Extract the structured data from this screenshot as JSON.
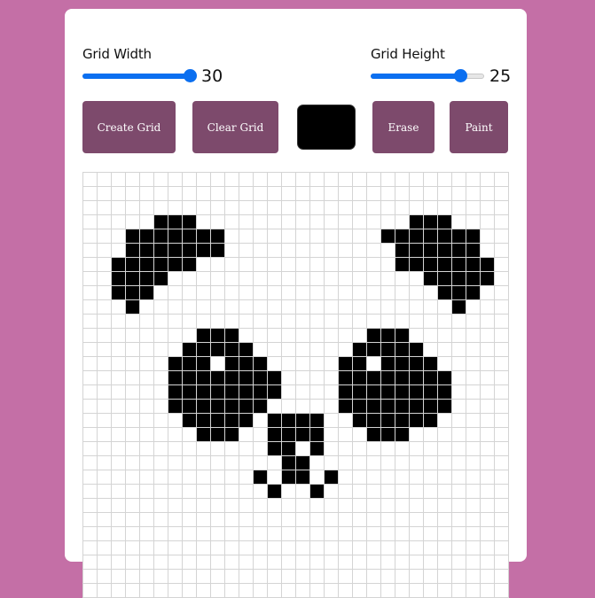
{
  "controls": {
    "width_label": "Grid Width",
    "width_value": "30",
    "width_min": 1,
    "width_max": 30,
    "width_current": 30,
    "height_label": "Grid Height",
    "height_value": "25",
    "height_min": 1,
    "height_max": 30,
    "height_current": 25
  },
  "buttons": {
    "create_label": "Create Grid",
    "clear_label": "Clear Grid",
    "erase_label": "Erase",
    "paint_label": "Paint"
  },
  "colors": {
    "paint_color": "#000000",
    "background": "#c46fa6",
    "button": "#7d4a6c",
    "accent": "#0b6ff0"
  },
  "grid": {
    "columns": 30,
    "rows": 30,
    "painted_rows": [
      "..............................",
      "..............................",
      "..............................",
      ".....OOO...............OOO....",
      "...OOOOOOO...........OOOOOOO..",
      "...OOOOOOO............OOOOOO..",
      "..OOOOOO..............OOOOOOO.",
      "..OOOO..................OOOOO.",
      "..OOO....................OOO..",
      "...O......................O...",
      "..............................",
      "........OOO.........OOO.......",
      ".......OOOOO.......OOOOO......",
      "......OOO.OOO.....OO.OOOO.....",
      "......OOOOOOOO....OOOOOOOO....",
      "......OOOOOOOO....OOOOOOOO....",
      "......OOOOOOO.....OOOOOOOO....",
      ".......OOOOO.OOOO..OOOOOO.....",
      "........OOO..OOOO...OOO.......",
      ".............OO.O.............",
      "..............OO..............",
      "............O.OO.O............",
      ".............O..O.............",
      "..............................",
      "..............................",
      "..............................",
      "..............................",
      "..............................",
      "..............................",
      ".............................."
    ]
  }
}
